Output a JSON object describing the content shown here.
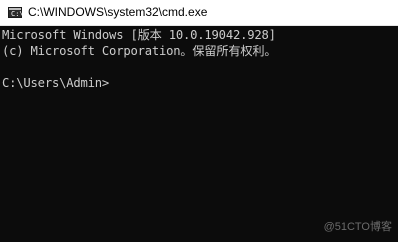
{
  "window": {
    "title": "C:\\WINDOWS\\system32\\cmd.exe",
    "icon": "cmd-icon"
  },
  "console": {
    "lines": [
      "Microsoft Windows [版本 10.0.19042.928]",
      "(c) Microsoft Corporation。保留所有权利。",
      "C:\\Users\\Admin>"
    ]
  },
  "watermark": "@51CTO博客",
  "colors": {
    "console_bg": "#0c0c0c",
    "console_text": "#cccccc",
    "titlebar_bg": "#ffffff"
  }
}
